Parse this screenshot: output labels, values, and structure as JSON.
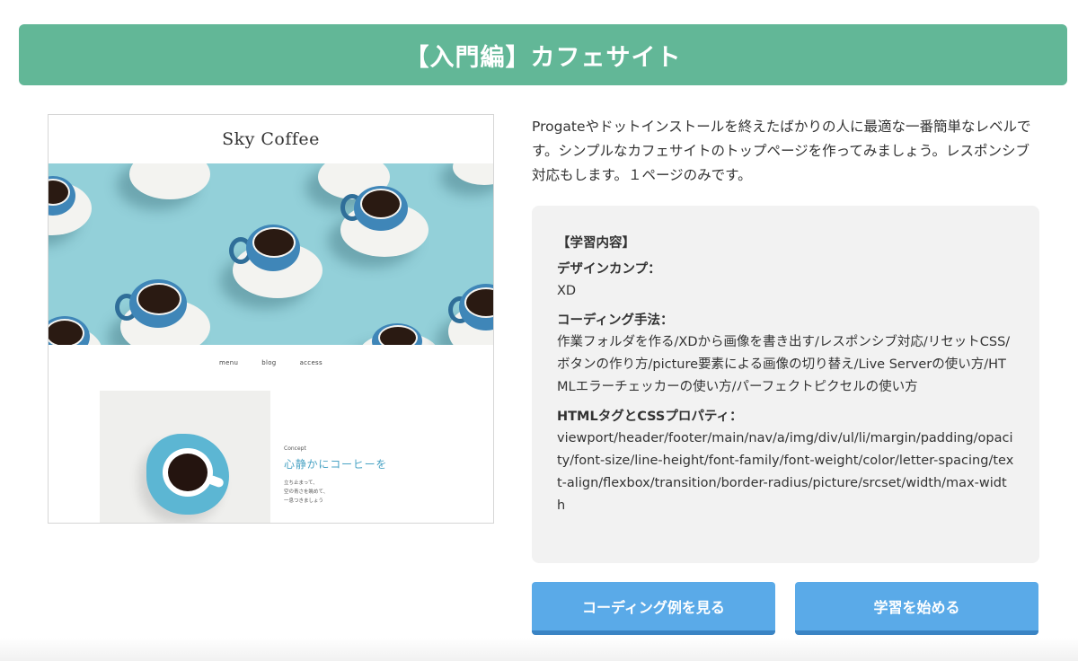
{
  "header": {
    "title": "【入門編】カフェサイト"
  },
  "preview": {
    "site_name": "Sky Coffee",
    "nav": [
      "menu",
      "blog",
      "access"
    ],
    "concept_label": "Concept",
    "concept_heading": "心静かにコーヒーを",
    "concept_lines": [
      "立ち止まって、",
      "空の青さを眺めて、",
      "一息つきましょう"
    ]
  },
  "description": "Progateやドットインストールを終えたばかりの人に最適な一番簡単なレベルです。シンプルなカフェサイトのトップページを作ってみましょう。レスポンシブ対応もします。１ページのみです。",
  "learning": {
    "heading": "【学習内容】",
    "sections": [
      {
        "label": "デザインカンプ：",
        "value": "XD"
      },
      {
        "label": "コーディング手法：",
        "value": "作業フォルダを作る/XDから画像を書き出す/レスポンシブ対応/リセットCSS/ボタンの作り方/picture要素による画像の切り替え/Live Serverの使い方/HTMLエラーチェッカーの使い方/パーフェクトピクセルの使い方"
      },
      {
        "label": "HTMLタグとCSSプロパティ：",
        "value": "viewport/header/footer/main/nav/a/img/div/ul/li/margin/padding/opacity/font-size/line-height/font-family/font-weight/color/letter-spacing/text-align/flexbox/transition/border-radius/picture/srcset/width/max-width"
      }
    ]
  },
  "buttons": {
    "example": "コーディング例を見る",
    "start": "学習を始める"
  },
  "colors": {
    "title_bar": "#62b797",
    "button": "#5aaae8",
    "button_shadow": "#3a84c4",
    "hero_bg": "#93d0d9",
    "concept_accent": "#4aa3c4"
  }
}
